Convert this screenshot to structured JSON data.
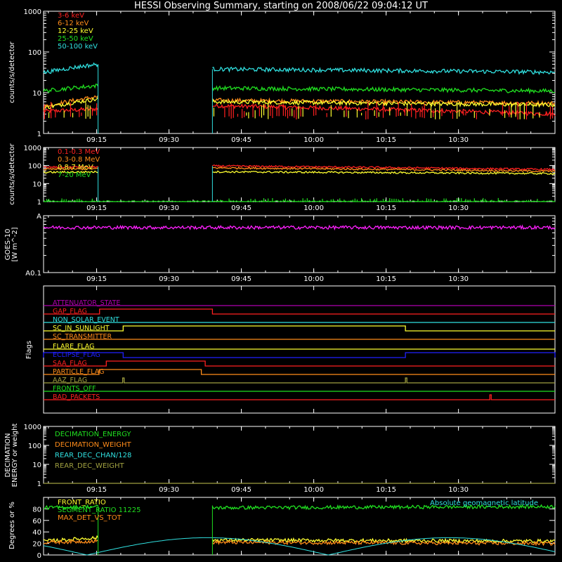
{
  "title": "HESSI Observing Summary, starting on 2008/06/22 09:04:12 UT",
  "colors": {
    "red": "#ff2020",
    "orange": "#ff8c1a",
    "yellow": "#ffff30",
    "green": "#20e020",
    "cyan": "#30e0e0",
    "magenta": "#ff20ff",
    "purple": "#b000b0",
    "blue": "#2020ff",
    "olive": "#a0a040",
    "gray": "#909090"
  },
  "time_axis": {
    "start_min": 0,
    "end_min": 106,
    "ticks": [
      {
        "t": 11,
        "label": "09:15"
      },
      {
        "t": 26,
        "label": "09:30"
      },
      {
        "t": 41,
        "label": "09:45"
      },
      {
        "t": 56,
        "label": "10:00"
      },
      {
        "t": 71,
        "label": "10:15"
      },
      {
        "t": 86,
        "label": "10:30"
      }
    ]
  },
  "chart_data": [
    {
      "type": "line",
      "id": "energy-low",
      "ylabel": "counts/s/detector",
      "yscale": "log",
      "ylim": [
        1,
        1000
      ],
      "yticks": [
        "1",
        "10",
        "100",
        "1000"
      ],
      "series": [
        {
          "name": "3-6 keV",
          "color": "#ff2020",
          "segments": [
            [
              0,
              11.3,
              3.5,
              4
            ],
            [
              35,
              106,
              4.8,
              3
            ]
          ]
        },
        {
          "name": "6-12 keV",
          "color": "#ff8c1a",
          "segments": [
            [
              0,
              11.3,
              4.5,
              8
            ],
            [
              35,
              106,
              6.5,
              5.5
            ]
          ]
        },
        {
          "name": "12-25 keV",
          "color": "#ffff30",
          "segments": [
            [
              0,
              11.3,
              4.2,
              7
            ],
            [
              35,
              106,
              6.0,
              5
            ]
          ]
        },
        {
          "name": "25-50 keV",
          "color": "#20e020",
          "segments": [
            [
              0,
              11.3,
              11,
              15
            ],
            [
              35,
              106,
              13,
              11
            ]
          ]
        },
        {
          "name": "50-100 keV",
          "color": "#30e0e0",
          "segments": [
            [
              0,
              11.3,
              31,
              50
            ],
            [
              35,
              106,
              38,
              32
            ]
          ]
        }
      ]
    },
    {
      "type": "line",
      "id": "energy-high",
      "ylabel": "counts/s/detector",
      "yscale": "log",
      "ylim": [
        1,
        1000
      ],
      "yticks": [
        "1",
        "10",
        "100",
        "1000"
      ],
      "series": [
        {
          "name": "0.1-0.3 MeV",
          "color": "#ff2020",
          "segments": [
            [
              0,
              11.3,
              80,
              85
            ],
            [
              35,
              106,
              95,
              60
            ]
          ]
        },
        {
          "name": "0.3-0.8 MeV",
          "color": "#ff8c1a",
          "segments": [
            [
              0,
              11.3,
              62,
              66
            ],
            [
              35,
              106,
              75,
              48
            ]
          ]
        },
        {
          "name": "0.8-7 MeV",
          "color": "#ffff30",
          "segments": [
            [
              0,
              11.3,
              42,
              45
            ],
            [
              35,
              106,
              45,
              36
            ]
          ]
        },
        {
          "name": "7-20 MeV",
          "color": "#20e020",
          "segments": [
            [
              0,
              106,
              1,
              1
            ]
          ]
        }
      ]
    },
    {
      "type": "line",
      "id": "goes",
      "ylabel": "GOES-10",
      "ylabel_unit": "[W m^-2]",
      "yscale": "log",
      "ylim": [
        0.1,
        1
      ],
      "yticks": [
        "A0.1",
        "A"
      ],
      "series": [
        {
          "name": "",
          "color": "#ff20ff",
          "segments": [
            [
              0,
              106,
              0.62,
              0.62
            ]
          ]
        }
      ]
    },
    {
      "type": "line",
      "id": "decimation",
      "ylabel": "DECIMATION",
      "ylabel2": "ENERGY or weight",
      "yscale": "log",
      "ylim": [
        1,
        1000
      ],
      "yticks": [
        "1",
        "10",
        "100",
        "1000"
      ],
      "series": [
        {
          "name": "DECIMATION_ENERGY",
          "color": "#20e020",
          "segments": []
        },
        {
          "name": "DECIMATION_WEIGHT",
          "color": "#ff8c1a",
          "segments": []
        },
        {
          "name": "REAR_DEC_CHAN/128",
          "color": "#30e0e0",
          "segments": []
        },
        {
          "name": "REAR_DEC_WEIGHT",
          "color": "#a0a040",
          "segments": [
            [
              0,
              106,
              1,
              1
            ]
          ]
        }
      ]
    },
    {
      "type": "line",
      "id": "ratios",
      "ylabel": "Degrees or %",
      "ylim": [
        0,
        100
      ],
      "yticks": [
        "0",
        "20",
        "40",
        "60",
        "80"
      ],
      "annotation": "Absolute geomagnetic latitude",
      "series": [
        {
          "name": "FRONT_RATIO",
          "color": "#ffff30",
          "segments": [
            [
              0,
              11.3,
              24,
              30
            ],
            [
              35,
              106,
              26,
              24
            ]
          ]
        },
        {
          "name": "SEGMENT_RATIO 11225",
          "color": "#20e020",
          "segments": [
            [
              0,
              11.3,
              82,
              84
            ],
            [
              35,
              106,
              82,
              84
            ]
          ]
        },
        {
          "name": "MAX_DET_VS_TOT",
          "color": "#ff8c1a",
          "segments": [
            [
              0,
              11.3,
              22,
              24
            ],
            [
              35,
              106,
              22,
              20
            ]
          ]
        }
      ]
    }
  ],
  "flags": {
    "ylabel": "Flags",
    "rows": [
      {
        "name": "ATTENUATOR_STATE",
        "color": "#b000b0",
        "high": []
      },
      {
        "name": "GAP_FLAG",
        "color": "#ff2020",
        "high": [
          [
            11.6,
            35
          ]
        ]
      },
      {
        "name": "NON_SOLAR_EVENT",
        "color": "#30e0e0",
        "high": []
      },
      {
        "name": "SC_IN_SUNLIGHT",
        "color": "#ffff30",
        "high": [
          [
            16.5,
            75
          ]
        ]
      },
      {
        "name": "SC_TRANSMITTER",
        "color": "#ff8c1a",
        "high": []
      },
      {
        "name": "FLARE_FLAG",
        "color": "#ffff30",
        "high": []
      },
      {
        "name": "ECLIPSE_FLAG",
        "color": "#2020ff",
        "high": [
          [
            0,
            16.5
          ],
          [
            75,
            106
          ]
        ]
      },
      {
        "name": "SAA_FLAG",
        "color": "#ff2020",
        "high": [
          [
            13,
            33.5
          ]
        ]
      },
      {
        "name": "PARTICLE_FLAG",
        "color": "#ff8c1a",
        "high": [
          [
            11.5,
            32.7
          ]
        ]
      },
      {
        "name": "AAZ_FLAG",
        "color": "#a0a040",
        "high": [
          [
            16.4,
            16.7
          ],
          [
            75,
            75.3
          ]
        ]
      },
      {
        "name": "FRONTS_OFF",
        "color": "#20e020",
        "high": []
      },
      {
        "name": "BAD_PACKETS",
        "color": "#ff2020",
        "high": [
          [
            92.5,
            92.8
          ]
        ]
      }
    ]
  }
}
